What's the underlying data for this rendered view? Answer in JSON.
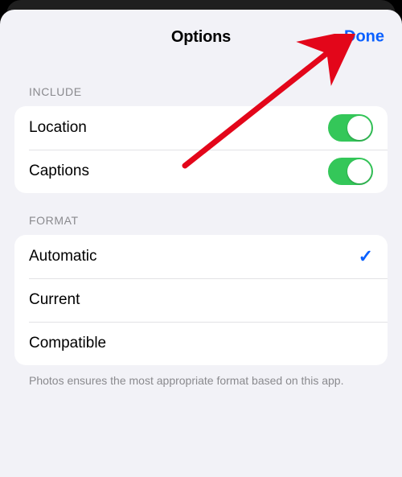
{
  "nav": {
    "title": "Options",
    "done": "Done"
  },
  "sections": {
    "include": {
      "header": "INCLUDE",
      "items": [
        {
          "label": "Location",
          "on": true
        },
        {
          "label": "Captions",
          "on": true
        }
      ]
    },
    "format": {
      "header": "FORMAT",
      "items": [
        {
          "label": "Automatic",
          "selected": true
        },
        {
          "label": "Current",
          "selected": false
        },
        {
          "label": "Compatible",
          "selected": false
        }
      ],
      "footer": "Photos ensures the most appropriate format based on this app."
    }
  },
  "annotation": {
    "type": "arrow",
    "color": "#e3061a"
  }
}
